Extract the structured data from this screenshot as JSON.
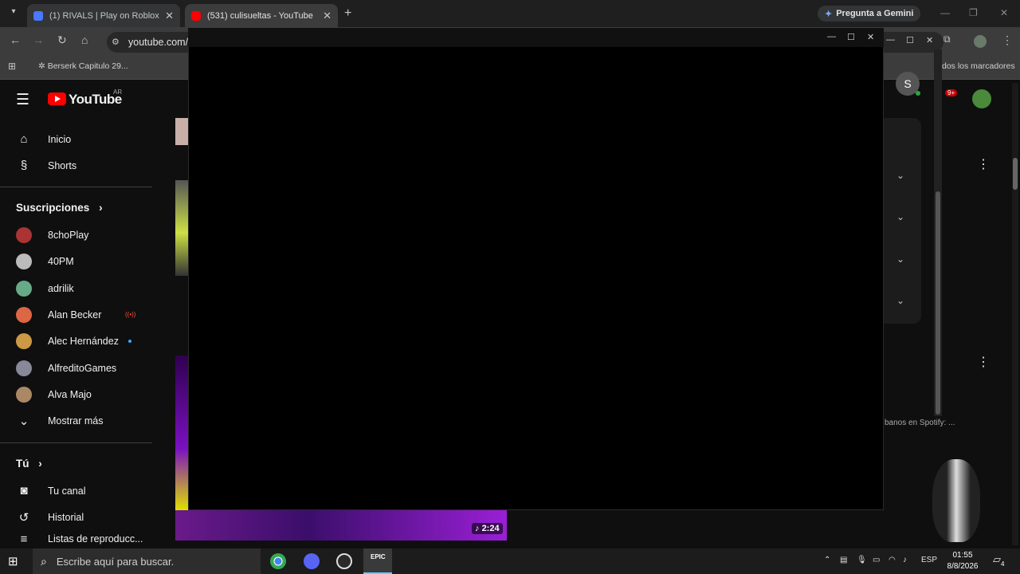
{
  "browser": {
    "tabs": [
      {
        "label": "(1) RIVALS | Play on Roblox",
        "favicon_color": "#4a78ff",
        "active": false
      },
      {
        "label": "(531) culisueltas - YouTube",
        "favicon_color": "#ff0000",
        "active": true
      }
    ],
    "gemini_label": "Pregunta a Gemini",
    "url": "youtube.com/",
    "bookmark": "Berserk Capitulo 29...",
    "all_bookmarks": "dos los marcadores"
  },
  "youtube": {
    "logo_text": "YouTube",
    "country": "AR",
    "nav": [
      {
        "label": "Inicio",
        "icon": "home-icon"
      },
      {
        "label": "Shorts",
        "icon": "shorts-icon"
      }
    ],
    "subscriptions_title": "Suscripciones",
    "subscriptions": [
      {
        "label": "8choPlay",
        "color": "#a33"
      },
      {
        "label": "40PM",
        "color": "#bbb"
      },
      {
        "label": "adrilik",
        "color": "#6a8"
      },
      {
        "label": "Alan Becker",
        "color": "#d64",
        "live": true
      },
      {
        "label": "Alec Hernández",
        "color": "#c94",
        "new": true
      },
      {
        "label": "AlfreditoGames",
        "color": "#889"
      },
      {
        "label": "Alva Majo",
        "color": "#a86"
      }
    ],
    "show_more": "Mostrar más",
    "you_title": "Tú",
    "you": [
      {
        "label": "Tu canal",
        "icon": "channel-icon"
      },
      {
        "label": "Historial",
        "icon": "history-icon"
      },
      {
        "label": "Listas de reproducc...",
        "icon": "playlists-icon"
      }
    ],
    "account_initial": "S",
    "notifications": "9+",
    "duration": "2:24",
    "spotify_text": "banos en Spotify: ..."
  },
  "taskbar": {
    "search_placeholder": "Escribe aquí para buscar.",
    "language": "ESP",
    "time": "01:55",
    "date": "8/8/2026",
    "notifications": "4"
  }
}
